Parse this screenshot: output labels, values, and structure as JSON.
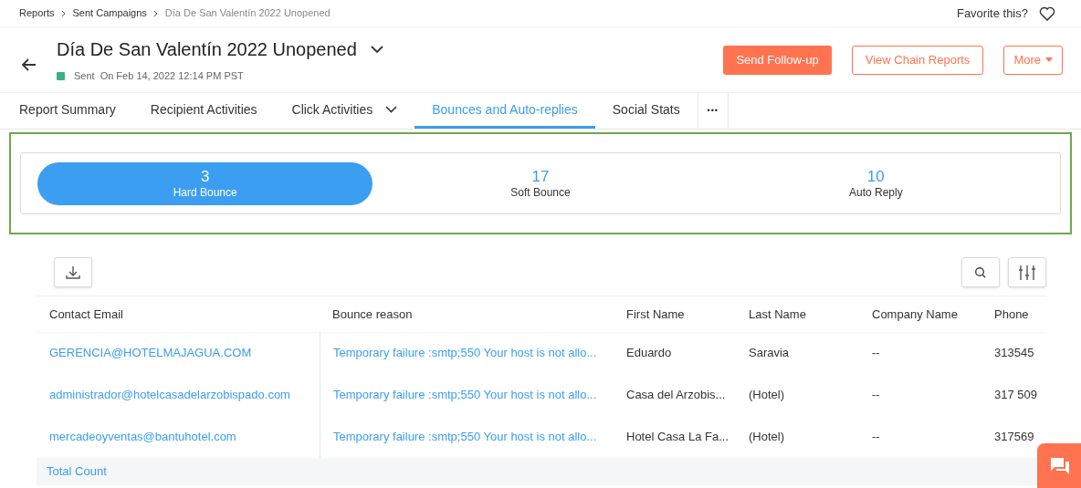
{
  "breadcrumb": [
    "Reports",
    "Sent Campaigns",
    "Día De San Valentín 2022 Unopened"
  ],
  "favorite": {
    "label": "Favorite this?"
  },
  "campaign": {
    "title": "Día De San Valentín 2022 Unopened",
    "status": "Sent",
    "sent_on": "On Feb 14, 2022 12:14 PM PST"
  },
  "actions": [
    "Send Follow-up",
    "View Chain Reports",
    "More"
  ],
  "tabs": [
    {
      "label": "Report Summary",
      "selected": false,
      "dropdown": false
    },
    {
      "label": "Recipient Activities",
      "selected": false,
      "dropdown": false
    },
    {
      "label": "Click Activities",
      "selected": false,
      "dropdown": true
    },
    {
      "label": "Bounces and Auto-replies",
      "selected": true,
      "dropdown": false
    },
    {
      "label": "Social Stats",
      "selected": false,
      "dropdown": false
    }
  ],
  "more_tabs": "•••",
  "segments": [
    {
      "count": "3",
      "label": "Hard Bounce",
      "selected": true
    },
    {
      "count": "17",
      "label": "Soft Bounce",
      "selected": false
    },
    {
      "count": "10",
      "label": "Auto Reply",
      "selected": false
    }
  ],
  "table": {
    "columns": [
      "Contact Email",
      "Bounce reason",
      "First Name",
      "Last Name",
      "Company Name",
      "Phone"
    ],
    "rows": [
      [
        "GERENCIA@HOTELMAJAGUA.COM",
        "Temporary failure :smtp;550 Your host is not allo...",
        "Eduardo",
        "Saravia",
        "--",
        "313545"
      ],
      [
        "administrador@hotelcasadelarzobispado.com",
        "Temporary failure :smtp;550 Your host is not allo...",
        "Casa del Arzobis...",
        "(Hotel)",
        "--",
        "317 509"
      ],
      [
        "mercadeoyventas@bantuhotel.com",
        "Temporary failure :smtp;550 Your host is not allo...",
        "Hotel Casa La Fa...",
        "(Hotel)",
        "--",
        "317569"
      ]
    ],
    "footer": "Total Count"
  }
}
